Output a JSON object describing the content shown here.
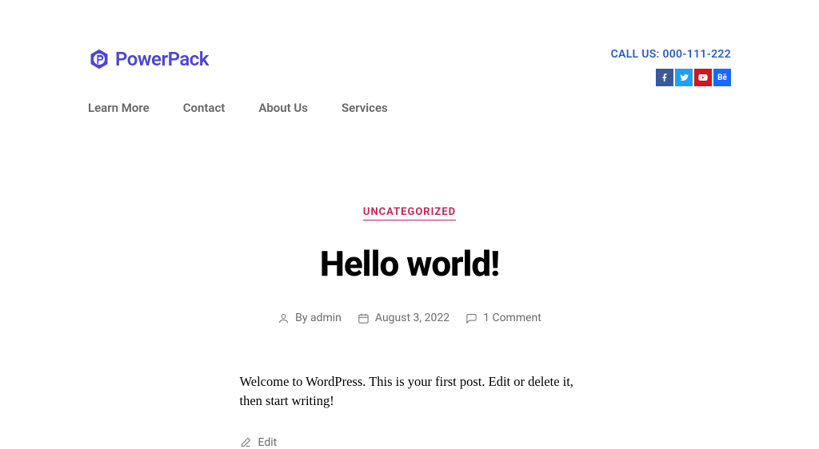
{
  "header": {
    "logo_text": "PowerPack",
    "callus_label": "CALL US: 000-111-222"
  },
  "nav": {
    "items": [
      {
        "label": "Learn More"
      },
      {
        "label": "Contact"
      },
      {
        "label": "About Us"
      },
      {
        "label": "Services"
      }
    ]
  },
  "post": {
    "category": "UNCATEGORIZED",
    "title": "Hello world!",
    "author_by": "By ",
    "author_name": "admin",
    "date": "August 3, 2022",
    "comments": "1 Comment",
    "content": "Welcome to WordPress. This is your first post. Edit or delete it, then start writing!",
    "edit_label": "Edit"
  }
}
